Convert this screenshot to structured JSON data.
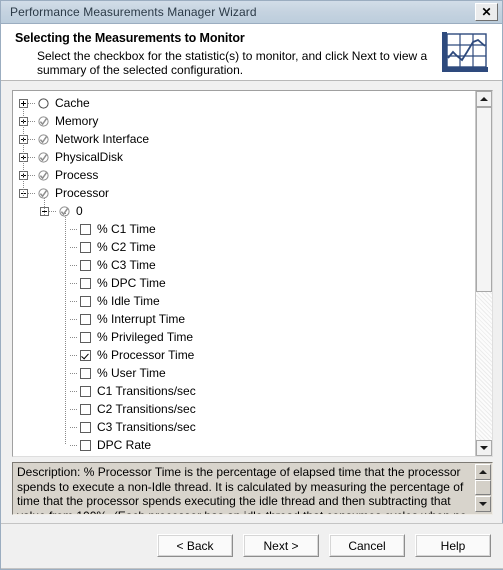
{
  "window": {
    "title": "Performance Measurements Manager Wizard",
    "close_label": "✕"
  },
  "header": {
    "title": "Selecting the Measurements to Monitor",
    "subtitle": "Select the checkbox for the statistic(s) to monitor, and click Next to view a summary of the selected configuration.",
    "icon": "line-chart-icon"
  },
  "tree": {
    "nodes": [
      {
        "label": "Cache",
        "depth": 0,
        "expander": "plus",
        "icon": "circle-empty",
        "type": "category"
      },
      {
        "label": "Memory",
        "depth": 0,
        "expander": "plus",
        "icon": "circle-check",
        "type": "category"
      },
      {
        "label": "Network Interface",
        "depth": 0,
        "expander": "plus",
        "icon": "circle-check",
        "type": "category"
      },
      {
        "label": "PhysicalDisk",
        "depth": 0,
        "expander": "plus",
        "icon": "circle-check",
        "type": "category"
      },
      {
        "label": "Process",
        "depth": 0,
        "expander": "plus",
        "icon": "circle-check",
        "type": "category"
      },
      {
        "label": "Processor",
        "depth": 0,
        "expander": "minus",
        "icon": "circle-check",
        "type": "category"
      },
      {
        "label": "0",
        "depth": 1,
        "expander": "minus",
        "icon": "circle-check",
        "type": "instance"
      },
      {
        "label": "% C1 Time",
        "depth": 2,
        "expander": "none",
        "icon": "checkbox",
        "checked": false,
        "type": "counter"
      },
      {
        "label": "% C2 Time",
        "depth": 2,
        "expander": "none",
        "icon": "checkbox",
        "checked": false,
        "type": "counter"
      },
      {
        "label": "% C3 Time",
        "depth": 2,
        "expander": "none",
        "icon": "checkbox",
        "checked": false,
        "type": "counter"
      },
      {
        "label": "% DPC Time",
        "depth": 2,
        "expander": "none",
        "icon": "checkbox",
        "checked": false,
        "type": "counter"
      },
      {
        "label": "% Idle Time",
        "depth": 2,
        "expander": "none",
        "icon": "checkbox",
        "checked": false,
        "type": "counter"
      },
      {
        "label": "% Interrupt Time",
        "depth": 2,
        "expander": "none",
        "icon": "checkbox",
        "checked": false,
        "type": "counter"
      },
      {
        "label": "% Privileged Time",
        "depth": 2,
        "expander": "none",
        "icon": "checkbox",
        "checked": false,
        "type": "counter"
      },
      {
        "label": "% Processor Time",
        "depth": 2,
        "expander": "none",
        "icon": "checkbox",
        "checked": true,
        "type": "counter"
      },
      {
        "label": "% User Time",
        "depth": 2,
        "expander": "none",
        "icon": "checkbox",
        "checked": false,
        "type": "counter"
      },
      {
        "label": "C1 Transitions/sec",
        "depth": 2,
        "expander": "none",
        "icon": "checkbox",
        "checked": false,
        "type": "counter"
      },
      {
        "label": "C2 Transitions/sec",
        "depth": 2,
        "expander": "none",
        "icon": "checkbox",
        "checked": false,
        "type": "counter"
      },
      {
        "label": "C3 Transitions/sec",
        "depth": 2,
        "expander": "none",
        "icon": "checkbox",
        "checked": false,
        "type": "counter"
      },
      {
        "label": "DPC Rate",
        "depth": 2,
        "expander": "none",
        "icon": "checkbox",
        "checked": false,
        "type": "counter"
      }
    ]
  },
  "description": {
    "text": "Description: % Processor Time is the percentage of elapsed time that the processor spends to execute a non-Idle thread. It is calculated by measuring the percentage of time that the processor spends executing the idle thread and then subtracting that value from 100%. (Each processor has an idle thread that consumes cycles when no other threads are ready to run.)"
  },
  "buttons": {
    "back": "< Back",
    "next": "Next >",
    "cancel": "Cancel",
    "help": "Help"
  },
  "colors": {
    "titlebar": "#c5d3e0",
    "icon_blue": "#2e4a7d",
    "description_bg": "#d8d4cc",
    "dialog_bg": "#f0f0f0"
  }
}
